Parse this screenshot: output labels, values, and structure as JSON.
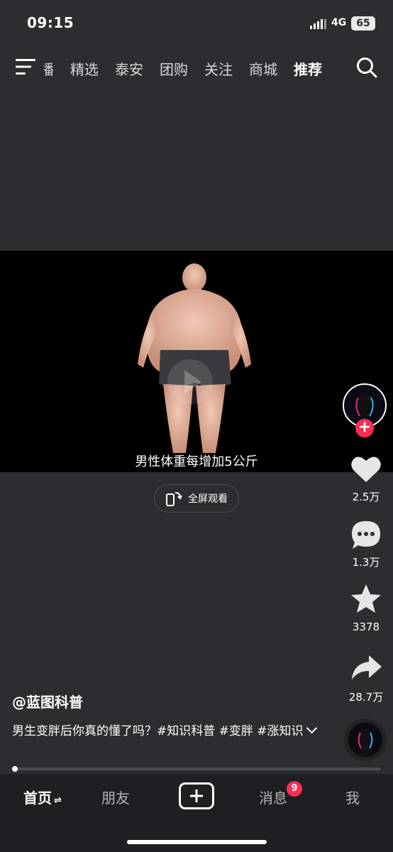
{
  "status_bar": {
    "time": "09:15",
    "network": "4G",
    "battery": "65"
  },
  "top_nav": {
    "tabs": [
      {
        "label": "播"
      },
      {
        "label": "精选"
      },
      {
        "label": "泰安"
      },
      {
        "label": "团购"
      },
      {
        "label": "关注"
      },
      {
        "label": "商城"
      },
      {
        "label": "推荐"
      }
    ],
    "active_tab": "推荐"
  },
  "video": {
    "caption": "男性体重每增加5公斤",
    "fullscreen_label": "全屏观看"
  },
  "actions": {
    "likes": "2.5万",
    "comments": "1.3万",
    "favorites": "3378",
    "shares": "28.7万"
  },
  "post": {
    "author": "@蓝图科普",
    "description": "男生变胖后你真的懂了吗？#知识科普 #变胖 #涨知识"
  },
  "bottom_nav": {
    "home": "首页",
    "friends": "朋友",
    "messages": "消息",
    "me": "我",
    "message_badge": "9"
  },
  "colors": {
    "background": "#2b2d31",
    "accent": "#fe2c55",
    "nav_bg": "#1e1f22"
  }
}
